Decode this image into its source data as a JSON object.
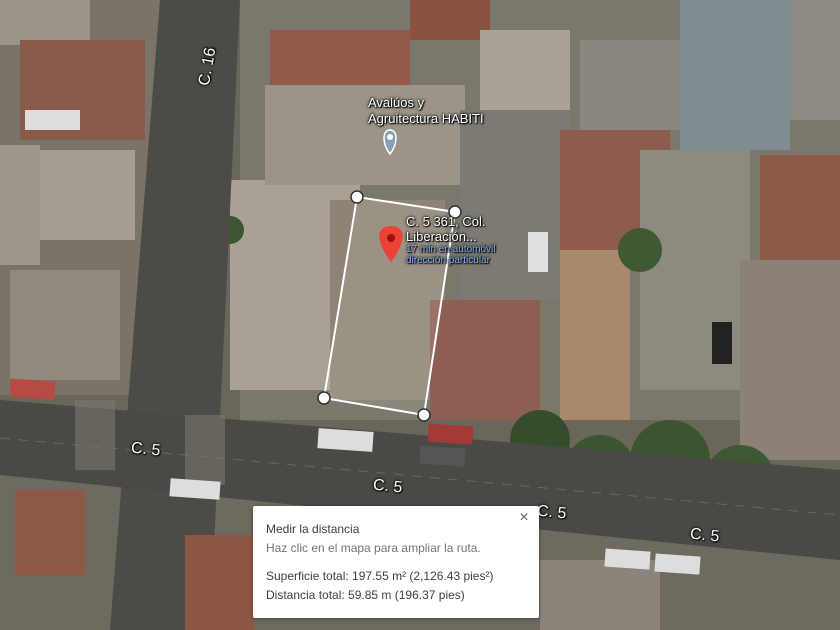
{
  "map": {
    "type": "satellite",
    "streets": [
      "C. 16",
      "C. 5",
      "C. 5",
      "C. 5",
      "C. 5"
    ],
    "poi": {
      "name_line1": "Avalúos y",
      "name_line2": "Agruitectura HABITI"
    },
    "place": {
      "name_line1": "C. 5 361, Col.",
      "name_line2": "Liberación...",
      "sub_line1": "17 min en automóvil",
      "sub_line2": "dirección particular",
      "pin_color": "#ea4335"
    },
    "measure_color": "#ffffff"
  },
  "measure_panel": {
    "title": "Medir la distancia",
    "hint": "Haz clic en el mapa para ampliar la ruta.",
    "area": "Superficie total: 197.55 m² (2,126.43 pies²)",
    "distance": "Distancia total: 59.85 m (196.37 pies)",
    "close_label": "×"
  }
}
